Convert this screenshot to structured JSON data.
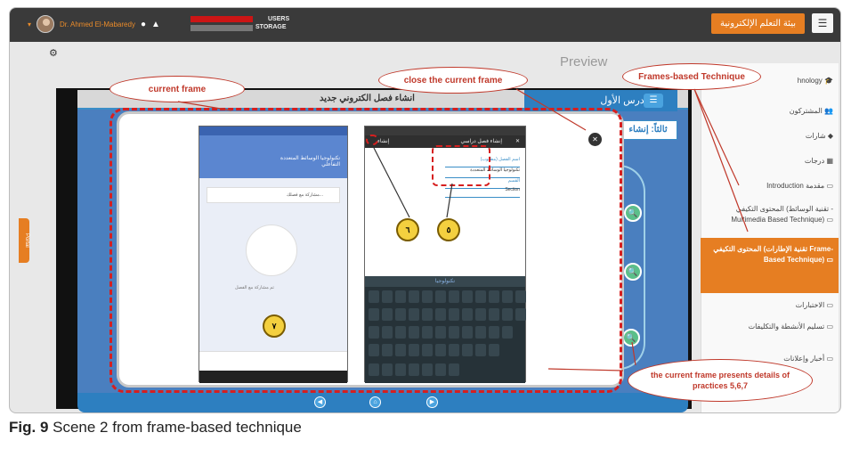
{
  "topbar": {
    "user_name": "Dr. Ahmed El-Mabaredy",
    "usage_users": "USERS",
    "usage_storage": "STORAGE",
    "brand": "بيئة التعلم الإلكترونية",
    "menu_icon": "hamburger-icon"
  },
  "preview_label": "Preview",
  "portal_tab": "Portal",
  "lesson": {
    "title": "انشاء فصل الكتروني جديد",
    "header": "الدرس الأول",
    "third_tab": "ثالثاً: إنشاء"
  },
  "sidebar": {
    "items": [
      {
        "label": "hnology",
        "icon": "graduation-cap-icon"
      },
      {
        "label": "المشتركون",
        "icon": "users-icon"
      },
      {
        "label": "شارات",
        "icon": "shield-icon"
      },
      {
        "label": "درجات",
        "icon": "table-icon"
      },
      {
        "label": "Introduction مقدمة",
        "icon": "folder-icon"
      },
      {
        "label": "المحتوى التكيفي (تقنية الوسائط -Multimedia Based Technique)",
        "icon": "folder-icon"
      },
      {
        "label": "المحتوى التكيفي (تقنية الإطارات Frame-Based Technique)",
        "icon": "folder-icon",
        "active": true
      },
      {
        "label": "الاختبارات",
        "icon": "folder-icon"
      },
      {
        "label": "تسليم الأنشطة والتكليفات",
        "icon": "folder-icon"
      },
      {
        "label": "أخبار وإعلانات",
        "icon": "folder-icon"
      }
    ]
  },
  "phone1": {
    "title": "تكنولوجيا الوسائط المتعددة",
    "subtitle": "التفاعلي",
    "share_text": "مشاركة مع فصلك...",
    "empty_text": "تم مشاركة مع الفصل"
  },
  "phone2": {
    "bar_title": "إنشاء فصل دراسي",
    "create_btn": "إنشاء",
    "field1_label": "اسم الفصل (مطلوب)",
    "field1_value": "تكنولوجيا الوسائط المتعددة",
    "field2_label": "القسم",
    "field2_value": "Section",
    "suggestion": "تكنولوجيا"
  },
  "badges": {
    "b6": "٦",
    "b5": "٥",
    "b7": "٧"
  },
  "callouts": {
    "current_frame": "current frame",
    "close_frame": "close the current frame",
    "frames_based": "Frames-based Technique",
    "presents": "the current frame presents details of practices 5,6,7"
  },
  "caption": {
    "label": "Fig. 9",
    "text": " Scene 2 from frame-based technique"
  },
  "colors": {
    "accent_orange": "#e67e22",
    "annotation_red": "#d61f1f",
    "lesson_blue": "#2d7fc0"
  }
}
